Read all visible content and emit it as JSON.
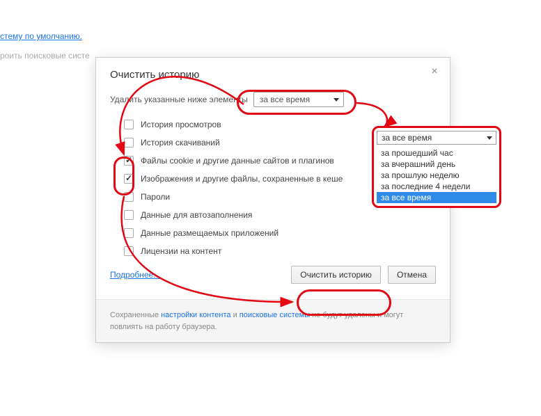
{
  "background": {
    "link_default": "стему по умолчанию.",
    "link_search": "роить поисковые систе"
  },
  "dialog": {
    "title": "Очистить историю",
    "prompt": "Удалить указанные ниже элементы",
    "time_selected": "за все время",
    "checkboxes": [
      {
        "label": "История просмотров",
        "checked": false
      },
      {
        "label": "История скачиваний",
        "checked": false
      },
      {
        "label": "Файлы cookie и другие данные сайтов и плагинов",
        "checked": true
      },
      {
        "label": "Изображения и другие файлы, сохраненные в кеше",
        "checked": true
      },
      {
        "label": "Пароли",
        "checked": false
      },
      {
        "label": "Данные для автозаполнения",
        "checked": false
      },
      {
        "label": "Данные размещаемых приложений",
        "checked": false
      },
      {
        "label": "Лицензии на контент",
        "checked": false
      }
    ],
    "more_link": "Подробнее...",
    "btn_clear": "Очистить историю",
    "btn_cancel": "Отмена",
    "footer_pre": "Сохраненные ",
    "footer_link1": "настройки контента",
    "footer_mid": " и ",
    "footer_link2": "поисковые системы",
    "footer_post": " не будут удалены и могут повлиять на работу браузера."
  },
  "dropdown": {
    "selected": "за все время",
    "options": [
      "за прошедший час",
      "за вчерашний день",
      "за прошлую неделю",
      "за последние 4 недели",
      "за все время"
    ],
    "highlight_index": 4
  }
}
